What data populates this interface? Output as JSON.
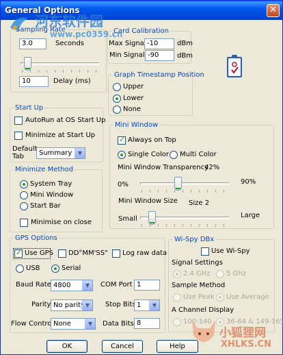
{
  "window": {
    "title": "General Options",
    "close_glyph": "✕"
  },
  "sampling": {
    "legend": "Sampling Rate",
    "value": "3.0",
    "seconds_label": "Seconds",
    "slider_level": 0.05,
    "delay_value": "10",
    "delay_label": "Delay (ms)"
  },
  "card_calibration": {
    "legend": "Card Calibration",
    "max_label": "Max Signal",
    "max_value": "-10",
    "min_label": "Min Signal",
    "min_value": "-90",
    "unit": "dBm"
  },
  "timestamp": {
    "legend": "Graph Timestamp Position",
    "options": [
      "Upper",
      "Lower",
      "None"
    ],
    "selected": "Lower"
  },
  "startup": {
    "legend": "Start Up",
    "auto_run": "AutoRun at OS Start Up",
    "minimize": "Minimize at Start Up",
    "default_tab_label": "Default Tab",
    "default_tab_value": "Summary"
  },
  "minimize_method": {
    "legend": "Minimize Method",
    "options": [
      "System Tray",
      "Mini Window",
      "Start Bar"
    ],
    "selected": "System Tray",
    "close_label": "Minimise on close"
  },
  "mini_window": {
    "legend": "Mini Window",
    "always_on_top": "Always on Top",
    "single_color": "Single Color",
    "multi_color": "Multi Color",
    "transparency_label": "Mini Window Transparency",
    "transparency_value": "42%",
    "transparency_min": "0%",
    "transparency_max": "90%",
    "transparency_level": 0.42,
    "size_label": "Mini Window Size",
    "size_value": "Size 2",
    "size_min": "Small",
    "size_max": "Large",
    "size_level": 0.1
  },
  "gps": {
    "legend": "GPS Options",
    "use_gps": "Use GPS",
    "dms": "DD°MM'SS\"",
    "raw": "Log raw data",
    "usb": "USB",
    "serial": "Serial",
    "baud_label": "Baud Rate",
    "baud_value": "4800",
    "com_label": "COM Port",
    "com_value": "1",
    "parity_label": "Parity",
    "parity_value": "No parity",
    "stopbits_label": "Stop Bits",
    "stopbits_value": "1",
    "flow_label": "Flow Control",
    "flow_value": "None",
    "databits_label": "Data Bits",
    "databits_value": "8"
  },
  "wispy": {
    "legend": "Wi-Spy DBx",
    "use_label": "Use Wi-Spy",
    "signal_settings": "Signal  Settings",
    "ghz24": "2.4 GHz",
    "ghz5": "5 Ghz",
    "sample_method": "Sample Method",
    "use_peak": "Use Peak",
    "use_average": "Use Average",
    "channel_display": "A Channel Display",
    "ch1": "100-140",
    "ch2": "36-64 & 149-165"
  },
  "buttons": {
    "ok": "OK",
    "cancel": "Cancel",
    "help": "Help"
  },
  "watermarks": {
    "top_cn": "河东软件园",
    "top_url": "www.pc0359.cn",
    "bottom_cn": "小狐狸网",
    "bottom_en": "XHLKS.CN"
  },
  "colors": {
    "title_blue": "#0058ee",
    "accent_green": "#21a121",
    "group_label": "#0046d5"
  }
}
